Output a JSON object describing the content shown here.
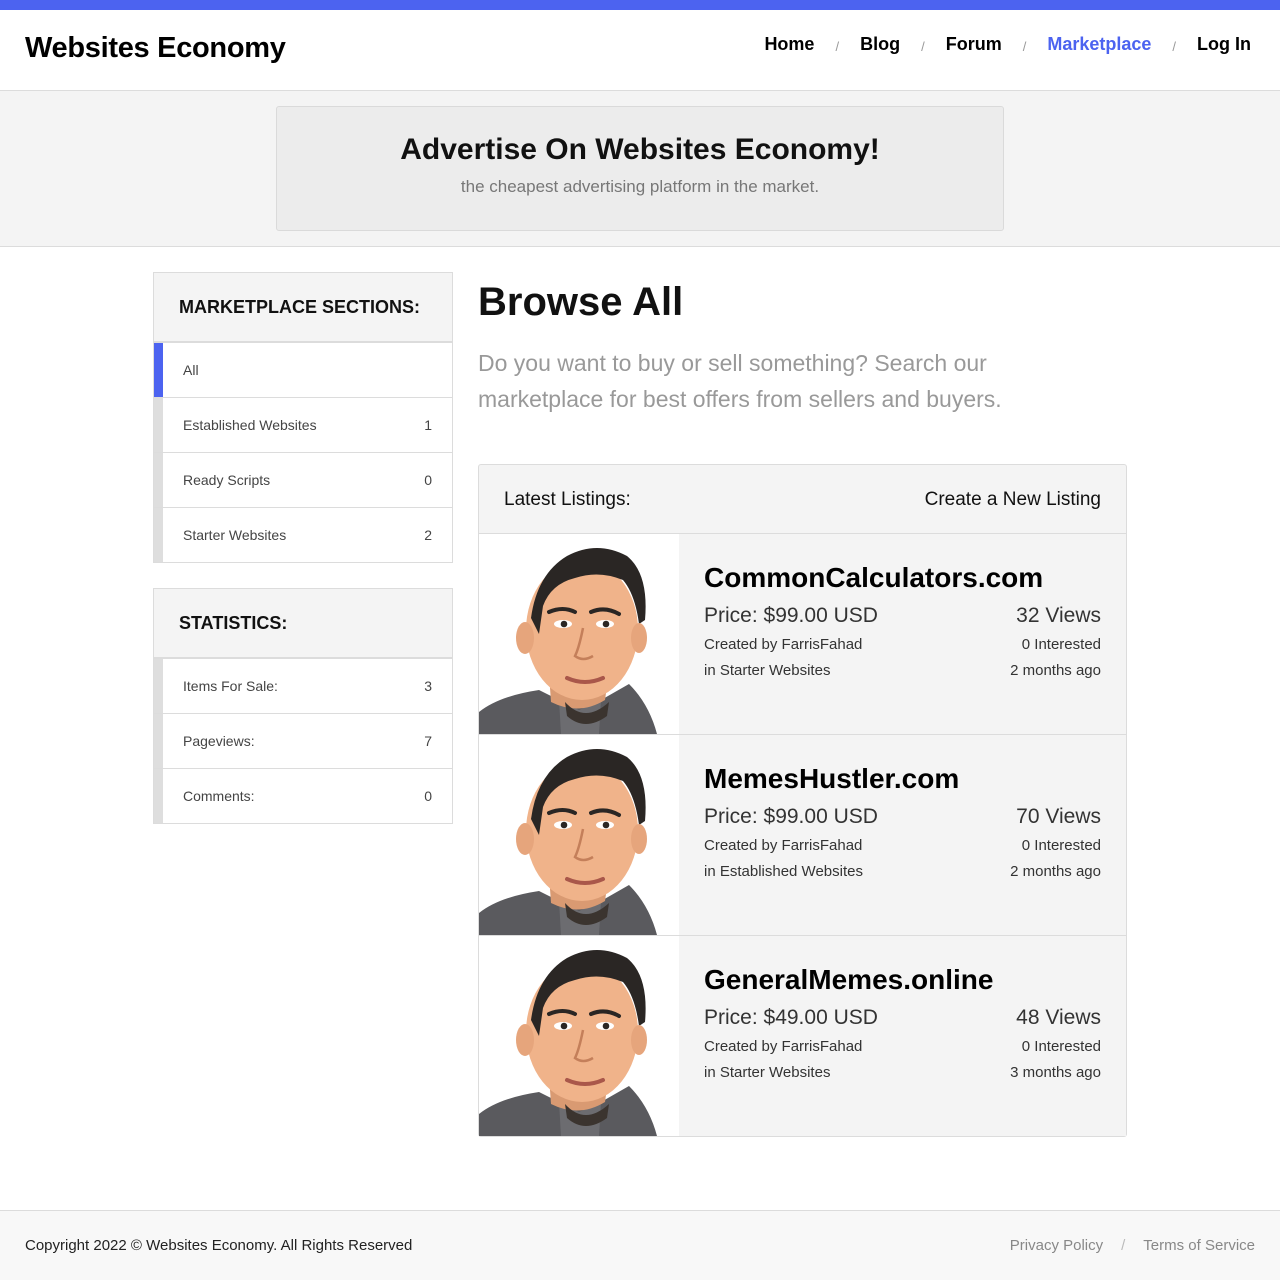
{
  "site": {
    "brand": "Websites Economy",
    "accent_color": "#4c63f0"
  },
  "nav": {
    "home": "Home",
    "blog": "Blog",
    "forum": "Forum",
    "marketplace": "Marketplace",
    "login": "Log In",
    "separator": "/"
  },
  "banner": {
    "title": "Advertise On Websites Economy!",
    "subtitle": "the cheapest advertising platform in the market."
  },
  "sections": {
    "heading": "MARKETPLACE SECTIONS:",
    "items": [
      {
        "label": "All",
        "count": ""
      },
      {
        "label": "Established Websites",
        "count": "1"
      },
      {
        "label": "Ready Scripts",
        "count": "0"
      },
      {
        "label": "Starter Websites",
        "count": "2"
      }
    ]
  },
  "statistics": {
    "heading": "STATISTICS:",
    "items": [
      {
        "label": "Items For Sale:",
        "count": "3"
      },
      {
        "label": "Pageviews:",
        "count": "7"
      },
      {
        "label": "Comments:",
        "count": "0"
      }
    ]
  },
  "main": {
    "title": "Browse All",
    "subtitle": "Do you want to buy or sell something? Search our marketplace for best offers from sellers and buyers."
  },
  "listings": {
    "heading": "Latest Listings:",
    "create_label": "Create a New Listing",
    "items": [
      {
        "title": "CommonCalculators.com",
        "price": "Price: $99.00 USD",
        "views": "32 Views",
        "created": "Created by FarrisFahad",
        "interested": "0 Interested",
        "category": "in Starter Websites",
        "ago": "2 months ago"
      },
      {
        "title": "MemesHustler.com",
        "price": "Price: $99.00 USD",
        "views": "70 Views",
        "created": "Created by FarrisFahad",
        "interested": "0 Interested",
        "category": "in Established Websites",
        "ago": "2 months ago"
      },
      {
        "title": "GeneralMemes.online",
        "price": "Price: $49.00 USD",
        "views": "48 Views",
        "created": "Created by FarrisFahad",
        "interested": "0 Interested",
        "category": "in Starter Websites",
        "ago": "3 months ago"
      }
    ]
  },
  "footer": {
    "copyright": "Copyright 2022 © Websites Economy. All Rights Reserved",
    "privacy": "Privacy Policy",
    "terms": "Terms of Service",
    "separator": "/"
  }
}
